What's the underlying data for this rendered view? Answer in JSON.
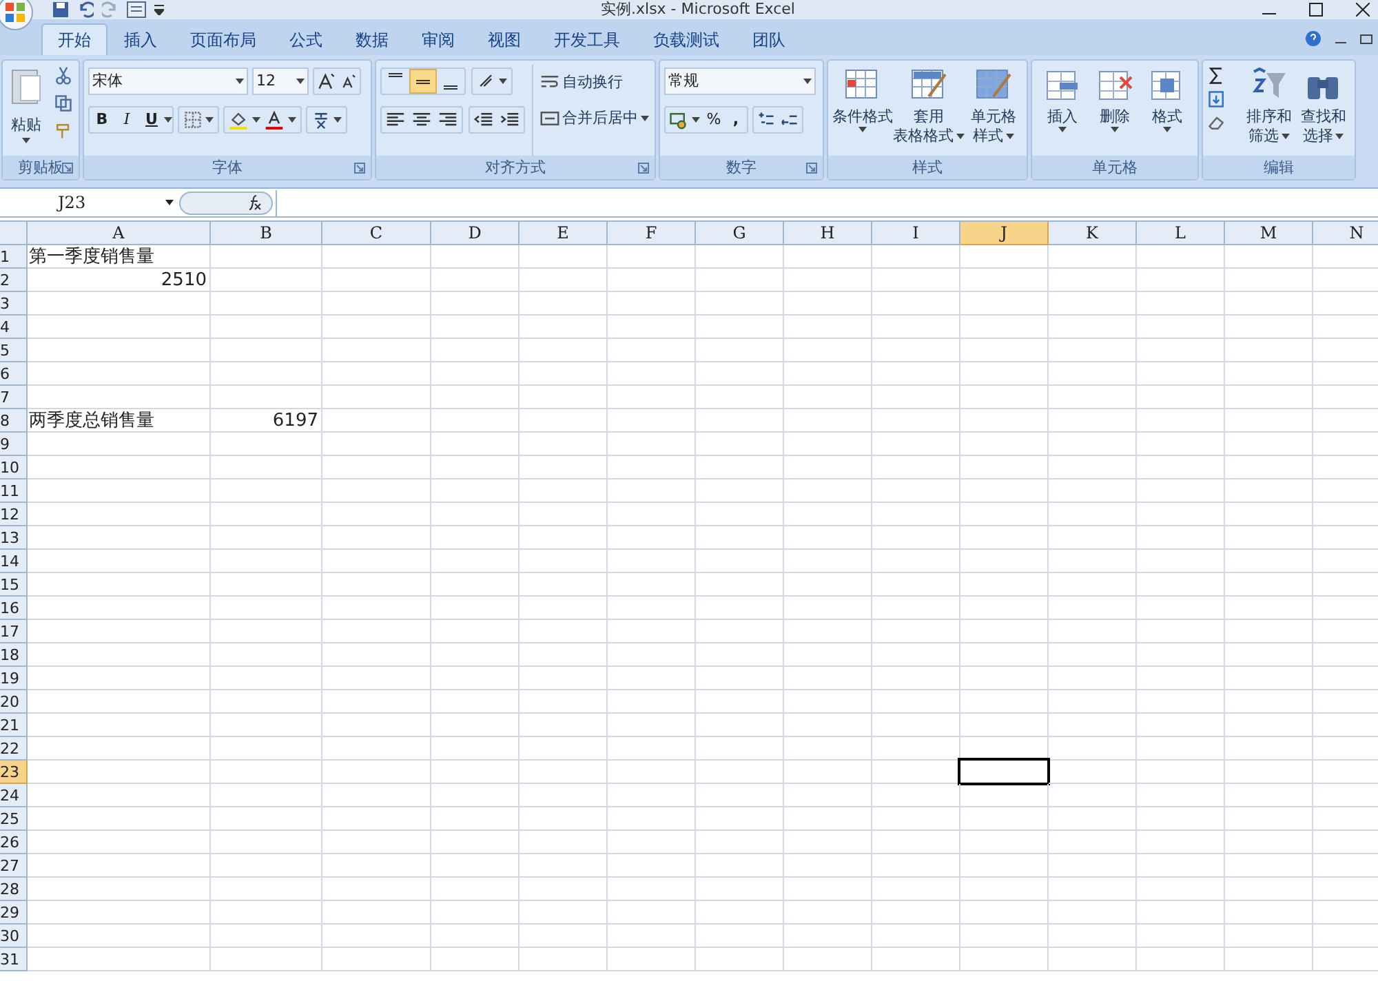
{
  "window": {
    "title": "实例.xlsx - Microsoft Excel"
  },
  "tabs": [
    {
      "label": "开始",
      "selected": true
    },
    {
      "label": "插入",
      "selected": false
    },
    {
      "label": "页面布局",
      "selected": false
    },
    {
      "label": "公式",
      "selected": false
    },
    {
      "label": "数据",
      "selected": false
    },
    {
      "label": "审阅",
      "selected": false
    },
    {
      "label": "视图",
      "selected": false
    },
    {
      "label": "开发工具",
      "selected": false
    },
    {
      "label": "负载测试",
      "selected": false
    },
    {
      "label": "团队",
      "selected": false
    }
  ],
  "ribbon": {
    "clipboard": {
      "paste": "粘贴",
      "label": "剪贴板"
    },
    "font": {
      "name": "宋体",
      "size": "12",
      "label": "字体",
      "bold": "B",
      "italic": "I",
      "underline": "U"
    },
    "alignment": {
      "vertical": [
        {
          "selected": false
        },
        {
          "selected": true
        },
        {
          "selected": false
        }
      ],
      "wrap": "自动换行",
      "merge": "合并后居中",
      "label": "对齐方式"
    },
    "number": {
      "format": "常规",
      "percent": "%",
      "comma": ",",
      "label": "数字"
    },
    "styles": {
      "buttons": [
        {
          "lines": [
            "条件格式"
          ]
        },
        {
          "lines": [
            "套用",
            "表格格式"
          ]
        },
        {
          "lines": [
            "单元格",
            "样式"
          ]
        }
      ],
      "label": "样式"
    },
    "cells": {
      "buttons": [
        {
          "lines": [
            "插入"
          ]
        },
        {
          "lines": [
            "删除"
          ]
        },
        {
          "lines": [
            "格式"
          ]
        }
      ],
      "label": "单元格"
    },
    "editing": {
      "buttons": [
        {
          "lines": [
            "排序和",
            "筛选"
          ]
        },
        {
          "lines": [
            "查找和",
            "选择"
          ]
        }
      ],
      "label": "编辑"
    }
  },
  "name_box": "J23",
  "columns": [
    {
      "label": "A",
      "selected": false
    },
    {
      "label": "B",
      "selected": false
    },
    {
      "label": "C",
      "selected": false
    },
    {
      "label": "D",
      "selected": false
    },
    {
      "label": "E",
      "selected": false
    },
    {
      "label": "F",
      "selected": false
    },
    {
      "label": "G",
      "selected": false
    },
    {
      "label": "H",
      "selected": false
    },
    {
      "label": "I",
      "selected": false
    },
    {
      "label": "J",
      "selected": true
    },
    {
      "label": "K",
      "selected": false
    },
    {
      "label": "L",
      "selected": false
    },
    {
      "label": "M",
      "selected": false
    },
    {
      "label": "N",
      "selected": false
    }
  ],
  "rows": [
    {
      "label": "1",
      "selected": false,
      "col_a": {
        "kind": "text",
        "text": "第一季度销售量"
      }
    },
    {
      "label": "2",
      "selected": false,
      "col_a": {
        "kind": "number",
        "text": "2510"
      }
    },
    {
      "label": "3",
      "selected": false
    },
    {
      "label": "4",
      "selected": false
    },
    {
      "label": "5",
      "selected": false
    },
    {
      "label": "6",
      "selected": false
    },
    {
      "label": "7",
      "selected": false
    },
    {
      "label": "8",
      "selected": false,
      "col_a": {
        "kind": "text",
        "text": "两季度总销售量"
      },
      "col_b": {
        "kind": "number",
        "text": "6197"
      }
    },
    {
      "label": "9",
      "selected": false
    },
    {
      "label": "10",
      "selected": false
    },
    {
      "label": "11",
      "selected": false
    },
    {
      "label": "12",
      "selected": false
    },
    {
      "label": "13",
      "selected": false
    },
    {
      "label": "14",
      "selected": false
    },
    {
      "label": "15",
      "selected": false
    },
    {
      "label": "16",
      "selected": false
    },
    {
      "label": "17",
      "selected": false
    },
    {
      "label": "18",
      "selected": false
    },
    {
      "label": "19",
      "selected": false
    },
    {
      "label": "20",
      "selected": false
    },
    {
      "label": "21",
      "selected": false
    },
    {
      "label": "22",
      "selected": false
    },
    {
      "label": "23",
      "selected": true
    },
    {
      "label": "24",
      "selected": false
    },
    {
      "label": "25",
      "selected": false
    },
    {
      "label": "26",
      "selected": false
    },
    {
      "label": "27",
      "selected": false
    },
    {
      "label": "28",
      "selected": false
    },
    {
      "label": "29",
      "selected": false
    },
    {
      "label": "30",
      "selected": false
    },
    {
      "label": "31",
      "selected": false
    }
  ]
}
